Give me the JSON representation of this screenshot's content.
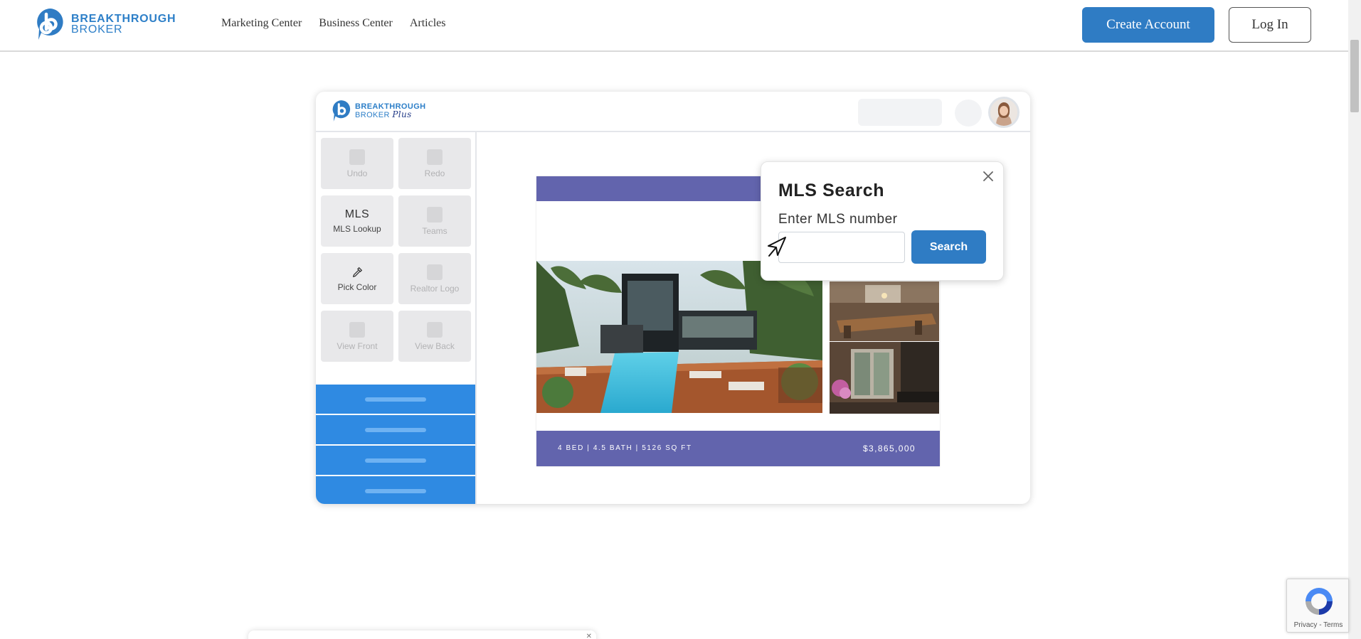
{
  "brand": {
    "line1": "BREAKTHROUGH",
    "line2": "BROKER",
    "accent_color": "#2f7cc4"
  },
  "nav": {
    "links": [
      "Marketing Center",
      "Business Center",
      "Articles"
    ],
    "create_account": "Create Account",
    "login": "Log In"
  },
  "demo": {
    "logo_line1": "BREAKTHROUGH",
    "logo_line2": "BROKER",
    "logo_plus": "Plus",
    "tools": [
      {
        "label": "Undo",
        "active": false
      },
      {
        "label": "Redo",
        "active": false
      },
      {
        "label": "MLS Lookup",
        "big": "MLS",
        "active": true
      },
      {
        "label": "Teams",
        "active": false
      },
      {
        "label": "Pick Color",
        "icon": "eyedropper-icon",
        "active": true
      },
      {
        "label": "Realtor Logo",
        "active": false
      },
      {
        "label": "View Front",
        "active": false
      },
      {
        "label": "View Back",
        "active": false
      }
    ],
    "flyer": {
      "info": "4 BED | 4.5 BATH | 5126 SQ FT",
      "price": "$3,865,000",
      "color": "#6264ad"
    },
    "mls_popup": {
      "title": "MLS Search",
      "subtitle": "Enter MLS number",
      "input_value": "",
      "button": "Search"
    }
  },
  "recaptcha": {
    "text": "Privacy - Terms"
  }
}
